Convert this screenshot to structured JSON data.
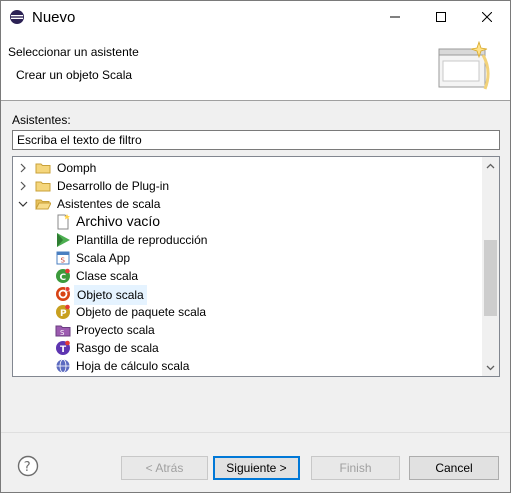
{
  "window": {
    "title": "Nuevo",
    "minimize_icon": "minimize-icon",
    "maximize_icon": "maximize-icon",
    "close_icon": "close-icon"
  },
  "header": {
    "title": "Seleccionar un asistente",
    "description": "Crear un objeto Scala",
    "graphic": "wizard-banner-icon"
  },
  "wizards": {
    "label": "Asistentes:",
    "filter_value": "Escriba el texto de filtro",
    "tree": [
      {
        "label": "Oomph",
        "icon": "folder-icon",
        "expander": "collapsed"
      },
      {
        "label": "Desarrollo de Plug-in",
        "icon": "folder-icon",
        "expander": "collapsed"
      },
      {
        "label": "Asistentes de scala",
        "icon": "folder-open-icon",
        "expander": "expanded"
      },
      {
        "label": "Archivo vacío",
        "icon": "empty-file-icon"
      },
      {
        "label": "Plantilla de reproducción",
        "icon": "play-template-icon"
      },
      {
        "label": "Scala App",
        "icon": "scala-app-icon"
      },
      {
        "label": "Clase scala",
        "icon": "scala-class-icon"
      },
      {
        "label": "Objeto scala",
        "icon": "scala-object-icon",
        "selected": true
      },
      {
        "label": "Objeto de paquete scala",
        "icon": "package-object-icon"
      },
      {
        "label": "Proyecto scala",
        "icon": "scala-project-icon"
      },
      {
        "label": "Rasgo de scala",
        "icon": "scala-trait-icon"
      },
      {
        "label": "Hoja de cálculo scala",
        "icon": "worksheet-icon"
      }
    ]
  },
  "buttons": {
    "back": "< Atrás",
    "next": "Siguiente >",
    "finish": "Finish",
    "cancel": "Cancel"
  },
  "colors": {
    "selection": "#e5f3ff",
    "default_button_border": "#0078d7",
    "folder": "#dcb35c"
  }
}
